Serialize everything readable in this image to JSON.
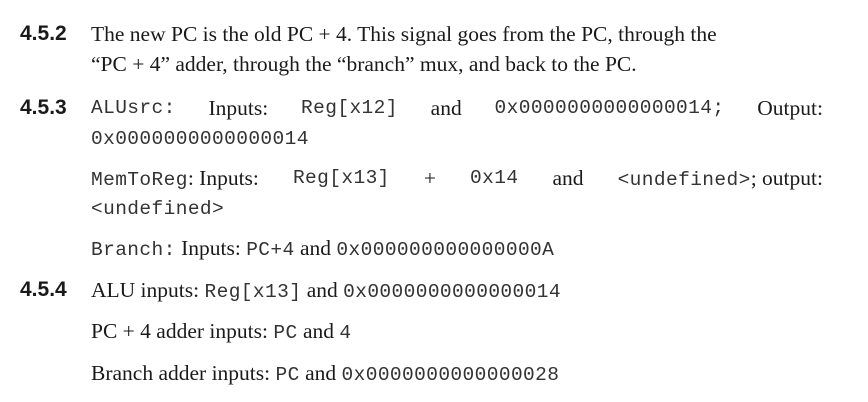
{
  "s452": {
    "number": "4.5.2",
    "line1": "The new PC is the old PC + 4. This signal goes from the PC, through the",
    "line2": "“PC + 4” adder, through the “branch” mux, and back to the PC."
  },
  "s453": {
    "number": "4.5.3",
    "alusrc": {
      "code": "ALUsrc:",
      "inputs_label": "Inputs:",
      "input1": "Reg[x12]",
      "and": "and",
      "input2": "0x0000000000000014;",
      "output_label": "Output:",
      "output": "0x0000000000000014"
    },
    "memtoreg": {
      "code": "MemToReg",
      "inputs_label": ": Inputs:",
      "input1": "Reg[x13]",
      "plus": "+",
      "input2": "0x14",
      "and": "and",
      "input3": "<undefined>",
      "output_label": "; output:",
      "output": "<undefined>"
    },
    "branch": {
      "code": "Branch:",
      "inputs_label": " Inputs: ",
      "input1": "PC+4",
      "and": " and ",
      "input2": "0x000000000000000A"
    }
  },
  "s454": {
    "number": "4.5.4",
    "alu": {
      "label": "ALU inputs: ",
      "input1": "Reg[x13]",
      "and": " and ",
      "input2": "0x0000000000000014"
    },
    "pc4": {
      "label": "PC + 4 adder inputs: ",
      "input1": "PC",
      "and": " and ",
      "input2": "4"
    },
    "branch_adder": {
      "label": "Branch adder inputs: ",
      "input1": "PC",
      "and": " and ",
      "input2": "0x0000000000000028"
    }
  }
}
